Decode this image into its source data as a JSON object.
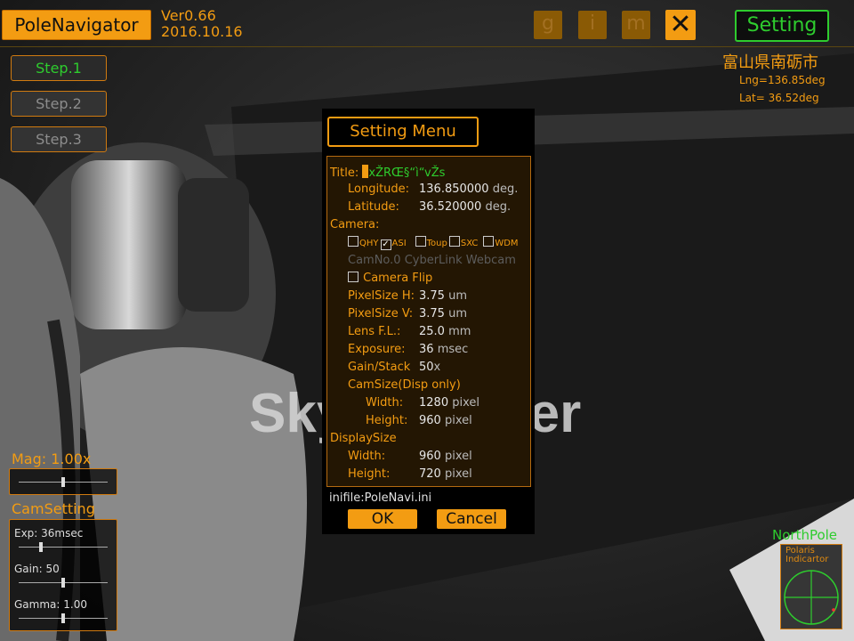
{
  "header": {
    "app_title": "PoleNavigator",
    "version": "Ver0.66",
    "date": "2016.10.16",
    "btn_g": "g",
    "btn_i": "i",
    "btn_m": "m",
    "close_label": "✕",
    "setting_label": "Setting"
  },
  "location": {
    "name": "富山県南砺市",
    "lng": "Lng=136.85deg",
    "lat": "Lat= 36.52deg"
  },
  "steps": [
    "Step.1",
    "Step.2",
    "Step.3"
  ],
  "mag": {
    "label": "Mag: 1.00x",
    "level": 0.5
  },
  "cam_setting": {
    "label": "CamSetting",
    "items": [
      {
        "label": "Exp: 36msec",
        "level": 0.25
      },
      {
        "label": "Gain: 50",
        "level": 0.5
      },
      {
        "label": "Gamma: 1.00",
        "level": 0.5
      }
    ]
  },
  "dialog": {
    "title": "Setting Menu",
    "title_label": "Title:",
    "title_value": "xŽRŒ§“ì“vŽs",
    "longitude_label": "Longitude:",
    "longitude_value": "136.850000",
    "longitude_unit": "deg.",
    "latitude_label": "Latitude:",
    "latitude_value": "36.520000",
    "latitude_unit": "deg.",
    "camera_label": "Camera:",
    "cameras": [
      {
        "label": "QHY",
        "checked": false
      },
      {
        "label": "ASI",
        "checked": true
      },
      {
        "label": "Toup",
        "checked": false
      },
      {
        "label": "SXC",
        "checked": false
      },
      {
        "label": "WDM",
        "checked": false
      }
    ],
    "cam_name": "CamNo.0 CyberLink Webcam",
    "camera_flip_label": "Camera Flip",
    "pixelsize_h_label": "PixelSize H:",
    "pixelsize_h_value": "3.75",
    "pixelsize_h_unit": "um",
    "pixelsize_v_label": "PixelSize V:",
    "pixelsize_v_value": "3.75",
    "pixelsize_v_unit": "um",
    "lens_label": "Lens F.L.:",
    "lens_value": "25.0",
    "lens_unit": "mm",
    "exposure_label": "Exposure:",
    "exposure_value": "36",
    "exposure_unit": "msec",
    "gain_label": "Gain/Stack",
    "gain_value": "50",
    "gain_unit": "x",
    "camsize_label": "CamSize(Disp only)",
    "cam_width_label": "Width:",
    "cam_width_value": "1280",
    "cam_width_unit": "pixel",
    "cam_height_label": "Height:",
    "cam_height_value": "960",
    "cam_height_unit": "pixel",
    "displaysize_label": "DisplaySize",
    "disp_width_label": "Width:",
    "disp_width_value": "960",
    "disp_width_unit": "pixel",
    "disp_height_label": "Height:",
    "disp_height_value": "720",
    "disp_height_unit": "pixel",
    "inifile": "inifile:PoleNavi.ini",
    "ok_label": "OK",
    "cancel_label": "Cancel"
  },
  "north_pole": {
    "label": "NorthPole",
    "line1": "Polaris",
    "line2": "Indicartor"
  },
  "background_text": "Sky-Watcher",
  "colors": {
    "accent": "#f39c12",
    "green": "#2ecc2e",
    "background": "#1e1e1e"
  }
}
